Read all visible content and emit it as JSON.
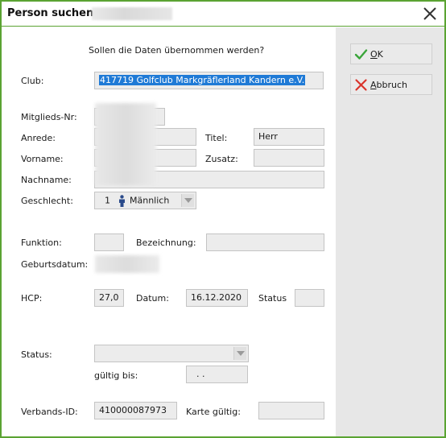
{
  "window": {
    "title": "Person suchen:"
  },
  "dialog": {
    "question": "Sollen die Daten übernommen werden?"
  },
  "buttons": {
    "ok_label_u": "O",
    "ok_label_rest": "K",
    "cancel_label_u": "A",
    "cancel_label_rest": "bbruch"
  },
  "form": {
    "club_label": "Club:",
    "club_value": "417719 Golfclub Markgräflerland Kandern e.V.",
    "member_no_label": "Mitglieds-Nr:",
    "salutation_label": "Anrede:",
    "title_label": "Titel:",
    "title_value": "Herr",
    "first_name_label": "Vorname:",
    "addition_label": "Zusatz:",
    "last_name_label": "Nachname:",
    "gender_label": "Geschlecht:",
    "gender_code": "1",
    "gender_value": "Männlich",
    "function_label": "Funktion:",
    "designation_label": "Bezeichnung:",
    "birthdate_label": "Geburtsdatum:",
    "hcp_label": "HCP:",
    "hcp_value": "27,0",
    "date_label": "Datum:",
    "date_value": "16.12.2020",
    "status_short_label": "Status",
    "status_label": "Status:",
    "valid_until_label": "gültig bis:",
    "valid_until_value": ". .",
    "association_id_label": "Verbands-ID:",
    "association_id_value": "410000087973",
    "card_valid_label": "Karte gültig:"
  },
  "colors": {
    "accent": "#5aa332",
    "selection": "#1f7ad6",
    "ok_icon": "#3aa53a",
    "cancel_icon": "#d9342b",
    "male_icon": "#2a4a8a"
  }
}
